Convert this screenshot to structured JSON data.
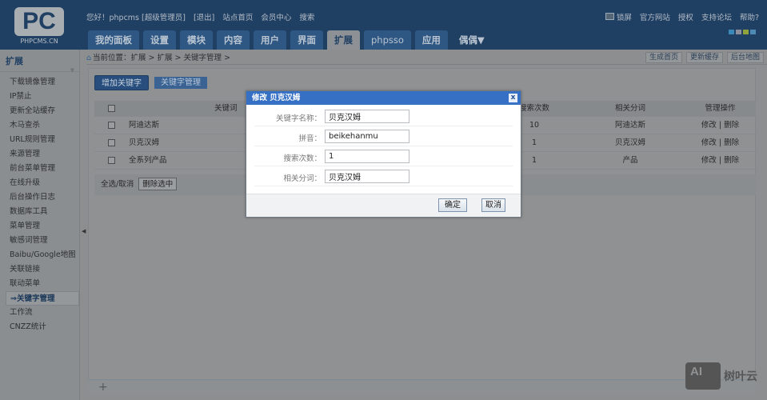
{
  "header": {
    "logo_text": "PC",
    "logo_subtitle": "PHPCMS.CN",
    "top_links": [
      "您好！phpcms [超级管理员]",
      "[退出]",
      "站点首页",
      "会员中心",
      "搜索"
    ],
    "right_links": [
      "锁屏",
      "官方网站",
      "授权",
      "支持论坛",
      "帮助?"
    ],
    "swatch_colors": [
      "#3b87b8",
      "#8b8f9c",
      "#8fa33a",
      "#4d8bb5"
    ],
    "tabs": [
      "我的面板",
      "设置",
      "模块",
      "内容",
      "用户",
      "界面",
      "扩展",
      "phpsso",
      "应用",
      "偶偶▼"
    ],
    "active_tab": "扩展"
  },
  "sidebar": {
    "title": "扩展",
    "items": [
      "下载镜像管理",
      "IP禁止",
      "更新全站缓存",
      "木马查杀",
      "URL规则管理",
      "来源管理",
      "前台菜单管理",
      "在线升级",
      "后台操作日志",
      "数据库工具",
      "菜单管理",
      "敏感词管理",
      "Baibu/Google地图",
      "关联链接",
      "联动菜单",
      "⇒关键字管理",
      "工作流",
      "CNZZ统计"
    ],
    "active": "⇒关键字管理"
  },
  "breadcrumb": {
    "text": "当前位置：扩展 > 扩展 > 关键字管理 >",
    "buttons": [
      "生成首页",
      "更新缓存",
      "后台地图"
    ]
  },
  "toolbar": {
    "add": "增加关键字",
    "manage": "关键字管理"
  },
  "table": {
    "headers": [
      "关键词",
      "搜索次数",
      "相关分词",
      "管理操作"
    ],
    "rows": [
      {
        "keyword": "阿迪达斯",
        "count": "10",
        "related": "阿迪达斯",
        "ops": "修改 | 删除"
      },
      {
        "keyword": "贝克汉姆",
        "count": "1",
        "related": "贝克汉姆",
        "ops": "修改 | 删除"
      },
      {
        "keyword": "全系列产品",
        "count": "1",
        "related": "产品",
        "ops": "修改 | 删除"
      }
    ],
    "select_all": "全选/取消",
    "delete_selected": "删除选中"
  },
  "dialog": {
    "title": "修改 贝克汉姆",
    "close": "x",
    "fields": [
      {
        "label": "关键字名称：",
        "value": "贝克汉姆"
      },
      {
        "label": "拼音：",
        "value": "beikehanmu"
      },
      {
        "label": "搜索次数：",
        "value": "1"
      },
      {
        "label": "相关分词：",
        "value": "贝克汉姆"
      }
    ],
    "ok": "确定",
    "cancel": "取消"
  },
  "watermark": {
    "icon": "AI",
    "text": "树叶云"
  }
}
